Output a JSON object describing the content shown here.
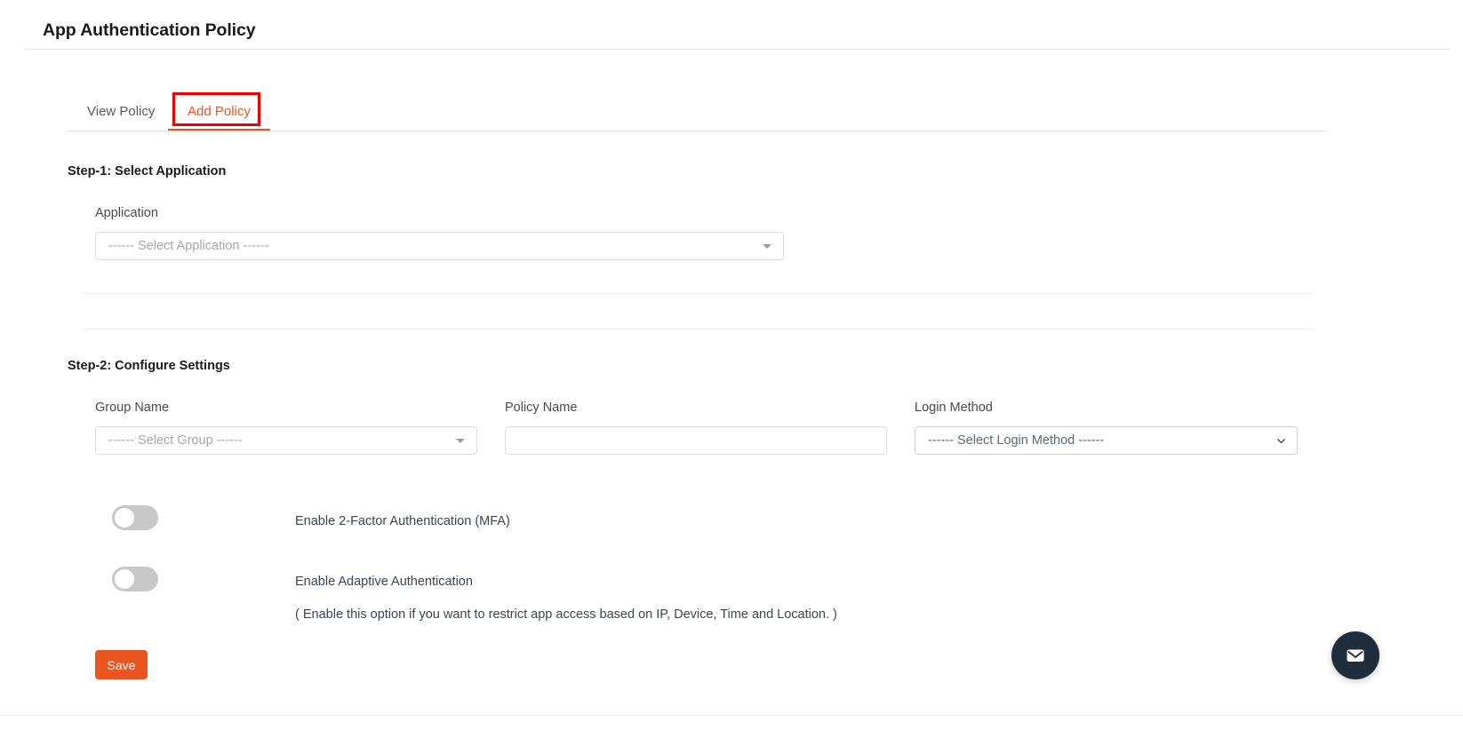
{
  "header": {
    "title": "App Authentication Policy"
  },
  "tabs": [
    {
      "id": "view-policy",
      "label": "View Policy",
      "active": false
    },
    {
      "id": "add-policy",
      "label": "Add Policy",
      "active": true
    }
  ],
  "annotation": {
    "target_tab": "Add Policy",
    "color": "#ee0000"
  },
  "step1": {
    "title": "Step-1: Select Application",
    "application": {
      "label": "Application",
      "value": "------ Select Application ------"
    }
  },
  "step2": {
    "title": "Step-2: Configure Settings",
    "group_name": {
      "label": "Group Name",
      "value": "------ Select Group ------"
    },
    "policy_name": {
      "label": "Policy Name",
      "value": "",
      "placeholder": ""
    },
    "login_method": {
      "label": "Login Method",
      "value": "------ Select Login Method ------"
    },
    "toggles": [
      {
        "id": "mfa",
        "label": "Enable 2-Factor Authentication (MFA)",
        "state": "off"
      },
      {
        "id": "adaptive",
        "label": "Enable Adaptive Authentication",
        "state": "off"
      }
    ],
    "helper_text": "( Enable this option if you want to restrict app access based on IP, Device, Time and Location. )"
  },
  "actions": {
    "save_label": "Save"
  },
  "chat_widget": {
    "icon": "envelope-icon"
  },
  "colors": {
    "accent": "#e8551f",
    "annotation": "#ee0000",
    "chat_bg": "#1f2d3d",
    "toggle_off": "#c8c8c8",
    "text_primary": "#1b1b1b",
    "text_muted": "#a8a8a8"
  }
}
